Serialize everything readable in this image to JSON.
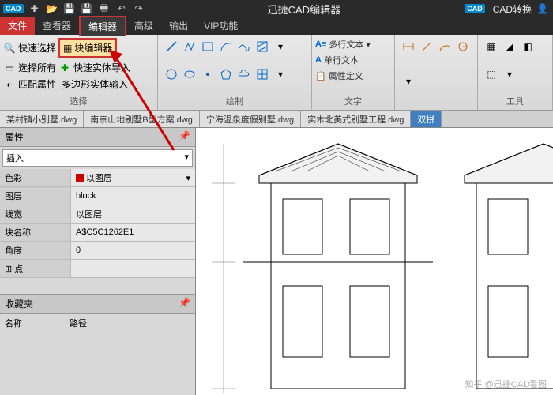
{
  "app": {
    "title": "迅捷CAD编辑器",
    "convert_label": "CAD转换"
  },
  "menu": {
    "file": "文件",
    "viewer": "查看器",
    "editor": "编辑器",
    "advanced": "高级",
    "output": "输出",
    "vip": "VIP功能"
  },
  "ribbon": {
    "select": {
      "label": "选择",
      "quick_select": "快速选择",
      "block_editor": "块编辑器",
      "select_all": "选择所有",
      "quick_import": "快速实体导入",
      "match_props": "匹配属性",
      "polygon_input": "多边形实体输入"
    },
    "draw": {
      "label": "绘制"
    },
    "text": {
      "label": "文字",
      "multi": "多行文本",
      "single": "单行文本",
      "attr": "属性定义"
    },
    "tools": {
      "label": "工具"
    }
  },
  "doc_tabs": [
    "某村镇小别墅.dwg",
    "南京山地别墅B型方案.dwg",
    "宁海温泉度假别墅.dwg",
    "实木北美式别墅工程.dwg",
    "双拼"
  ],
  "props": {
    "title": "属性",
    "insert": "插入",
    "rows": [
      {
        "k": "色彩",
        "v": "以图层",
        "color": true
      },
      {
        "k": "图层",
        "v": "block"
      },
      {
        "k": "线宽",
        "v": "以图层"
      },
      {
        "k": "块名称",
        "v": "A$C5C1262E1"
      },
      {
        "k": "角度",
        "v": "0"
      }
    ],
    "point": "点"
  },
  "favorites": {
    "title": "收藏夹",
    "name": "名称",
    "path": "路径"
  },
  "watermark": "知乎 @迅捷CAD看图"
}
